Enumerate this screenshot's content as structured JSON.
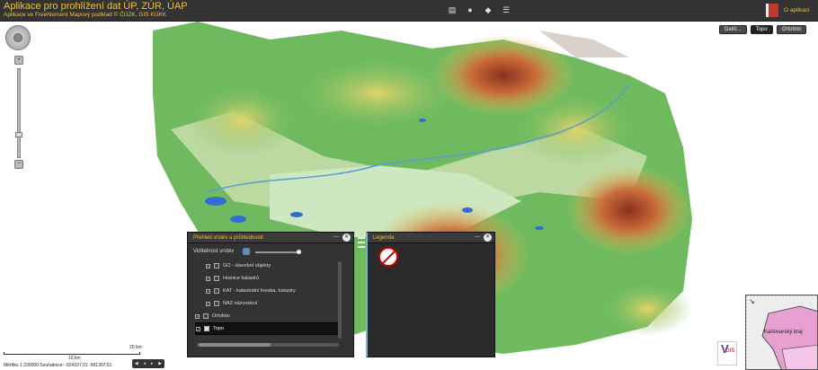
{
  "header": {
    "title": "Aplikace pro prohlížení dat ÚP, ZÚR, ÚAP",
    "subtitle": "Aplikace ve Freehlement Mapový podklad © ČÚZK, GIS KÚKK",
    "about_label": "O aplikaci"
  },
  "basemap": {
    "prev_label": "Další...",
    "options": [
      "Topo",
      "Ortofoto"
    ],
    "selected": "Topo"
  },
  "layers_panel": {
    "title": "Přehled vrstev a průhlednosti",
    "visibility_label": "Viditelnost vrstev",
    "visibility_value": 0.9,
    "items": [
      {
        "label": "GO - stavební objekty",
        "level": "sub",
        "checked": false
      },
      {
        "label": "Hranice katastrů",
        "level": "sub",
        "checked": false
      },
      {
        "label": "KAT - katastrální kresba, katastry",
        "level": "sub",
        "checked": false
      },
      {
        "label": "NAZ názvosloví",
        "level": "sub",
        "checked": false
      },
      {
        "label": "Ortofoto",
        "level": "top",
        "checked": false
      },
      {
        "label": "Topo",
        "level": "top",
        "checked": true
      }
    ]
  },
  "legend_panel": {
    "title": "Legenda"
  },
  "scale": {
    "bar_20": "20 km",
    "bar_10": "10 km",
    "info": "Měřítko 1:230000   Souřadnice: -924107,01 -991397,01"
  },
  "overview": {
    "label": "Karlovarský kraj"
  },
  "logo": {
    "letter": "V",
    "sub": "GIS"
  },
  "colors": {
    "header_bg": "#333333",
    "accent": "#f1c232",
    "panel_bg": "#333333"
  },
  "icons": {
    "top_tools": [
      "layers-icon",
      "globe-icon",
      "stack-icon",
      "list-icon"
    ]
  }
}
